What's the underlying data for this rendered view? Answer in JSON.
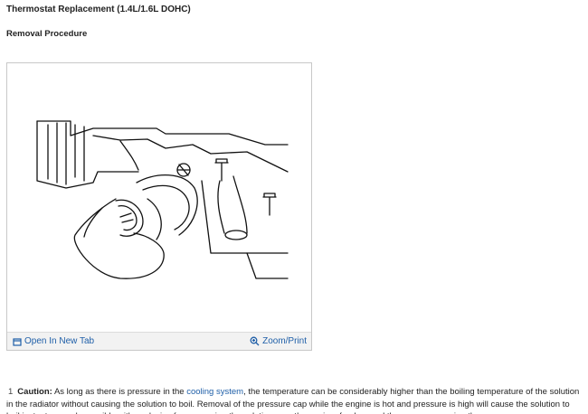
{
  "header": {
    "title": "Thermostat Replacement (1.4L/1.6L DOHC)",
    "subtitle": "Removal Procedure"
  },
  "figure": {
    "open_tab_label": "Open In New Tab",
    "zoom_label": "Zoom/Print",
    "icons": {
      "open_tab": "new-tab-icon",
      "zoom": "magnifier-icon"
    }
  },
  "steps": [
    {
      "number": "1",
      "caution_label": "Caution:",
      "text_a": "As long as there is pressure in the",
      "link_text": "cooling system",
      "text_b": ", the temperature can be considerably higher than the boiling temperature of the solution in the radiator without causing the solution to boil. Removal of the pressure cap while the engine is hot and pressure is high will cause the solution to boil instantaneously possibly with explosive force spewing the solution over the engine, fenders and the person removing the cap."
    }
  ],
  "colors": {
    "link": "#1f5fa8",
    "figure_border": "#c8c8c8",
    "toolbar_bg": "#f2f2f2"
  }
}
